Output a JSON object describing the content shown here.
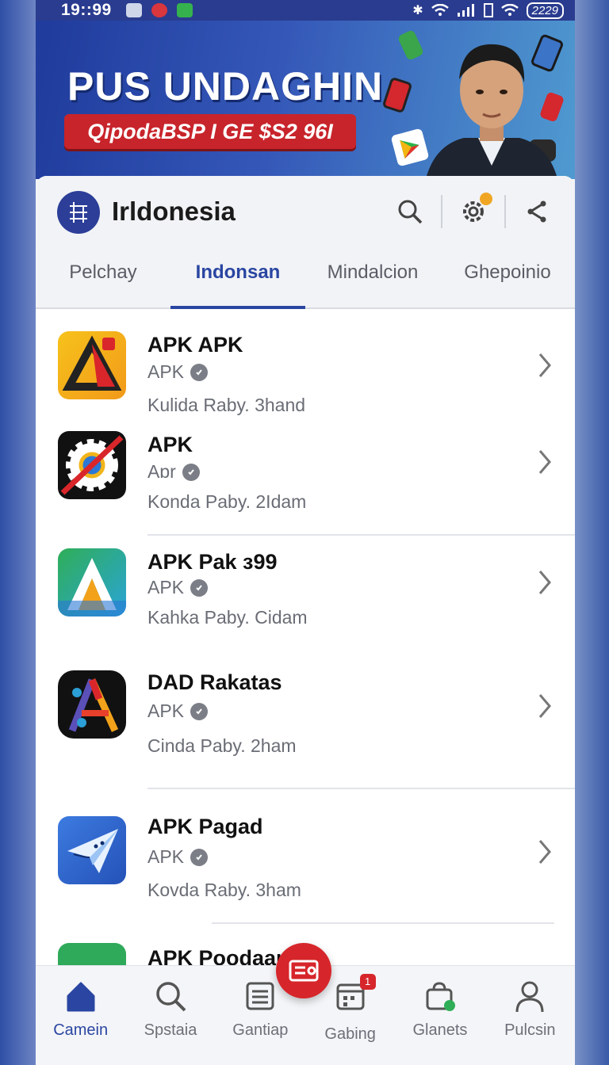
{
  "status_bar": {
    "time": "19::99",
    "battery": "2229"
  },
  "banner": {
    "title": "PUS UNDAGHIN",
    "subtitle": "QipodaBSP I GE $S2 96I"
  },
  "header": {
    "title": "Irldonesia"
  },
  "tabs": [
    {
      "label": "Pelchay",
      "active": false
    },
    {
      "label": "Indonsan",
      "active": true
    },
    {
      "label": "Mindalcion",
      "active": false
    },
    {
      "label": "Ghepoinio",
      "active": false
    }
  ],
  "apps": [
    {
      "name": "APK APK",
      "tag": "APK",
      "meta": "Kulida Raby. 3hand",
      "icon": "triangle-logo-icon"
    },
    {
      "name": "APK",
      "tag": "Aɒr",
      "meta": "Konda Paby. 2Idam",
      "icon": "gear-chrome-icon"
    },
    {
      "name": "APK Pak ɜ99",
      "tag": "APK",
      "meta": "Kahka Paby. Cidam",
      "icon": "letter-a-icon"
    },
    {
      "name": "DAD Rakatas",
      "tag": "APK",
      "meta": "Cinda Paby. 2ham",
      "icon": "abstract-a-icon"
    },
    {
      "name": "APK Pagad",
      "tag": "APK",
      "meta": "Kovda Raby. 3ham",
      "icon": "paper-plane-icon"
    },
    {
      "name": "APK Poodaan",
      "tag": "",
      "meta": "",
      "icon": "green-app-icon"
    }
  ],
  "bottom_nav": [
    {
      "label": "Camein",
      "icon": "home-icon",
      "active": true
    },
    {
      "label": "Spstaia",
      "icon": "search-icon",
      "active": false
    },
    {
      "label": "Gantiap",
      "icon": "list-icon",
      "active": false
    },
    {
      "label": "Gabing",
      "icon": "calendar-icon",
      "active": false,
      "badge": "1"
    },
    {
      "label": "Glanets",
      "icon": "bag-icon",
      "active": false
    },
    {
      "label": "Pulcsin",
      "icon": "person-icon",
      "active": false
    }
  ],
  "colors": {
    "brand": "#2a46a2",
    "accent_red": "#d6262b"
  }
}
